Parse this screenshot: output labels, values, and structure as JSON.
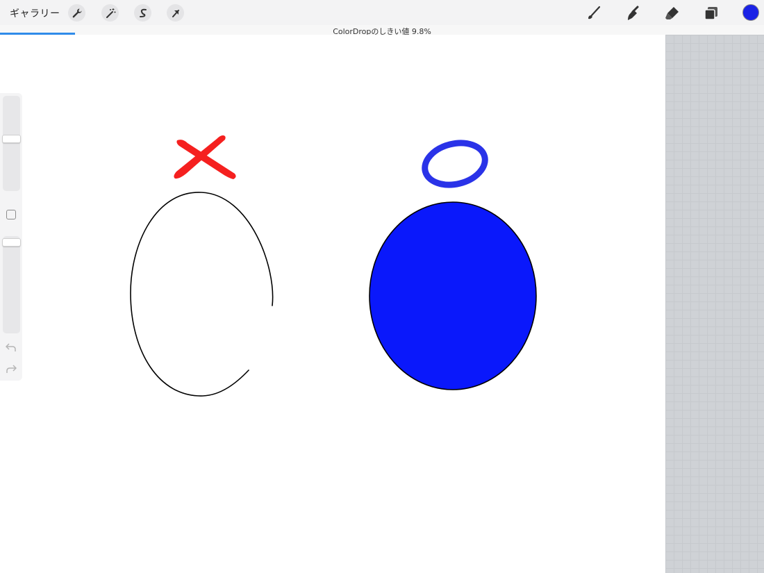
{
  "app": {
    "gallery_label": "ギャラリー",
    "toolbar_icons": [
      "wrench-icon",
      "magic-wand-icon",
      "selection-icon",
      "transform-arrow-icon"
    ],
    "right_tools": [
      "brush-icon",
      "smudge-icon",
      "eraser-icon",
      "layers-icon",
      "color-icon"
    ],
    "current_color": "#1a22e6"
  },
  "status": {
    "text": "ColorDropのしきい値 9.8%",
    "threshold_percent": 9.8
  },
  "canvas_drawing": {
    "red_cross_color": "#f5201f",
    "blue_o_color": "#2a33e8",
    "filled_ellipse_color": "#0a18fb",
    "open_ellipse_stroke": "#000000"
  },
  "sidebar": {
    "brush_size_level": 0.55,
    "opacity_level": 0.95,
    "undo_icon": "undo-icon",
    "redo_icon": "redo-icon"
  }
}
